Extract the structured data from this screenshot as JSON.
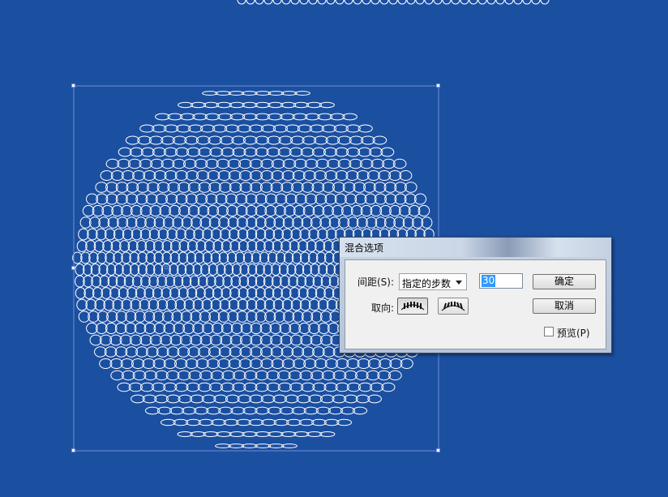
{
  "dialog": {
    "title": "混合选项",
    "spacing_label": "间距(S):",
    "spacing_value": "指定的步数",
    "steps_value": "30",
    "orientation_label": "取向:",
    "orientation_buttons": [
      "align-to-page-icon",
      "align-to-path-icon"
    ],
    "ok_label": "确定",
    "cancel_label": "取消",
    "preview_label": "预览(P)",
    "preview_checked": false
  },
  "colors": {
    "background": "#1b4fa0",
    "artwork_stroke": "#ffffff",
    "selection": "#6f8fd8"
  }
}
